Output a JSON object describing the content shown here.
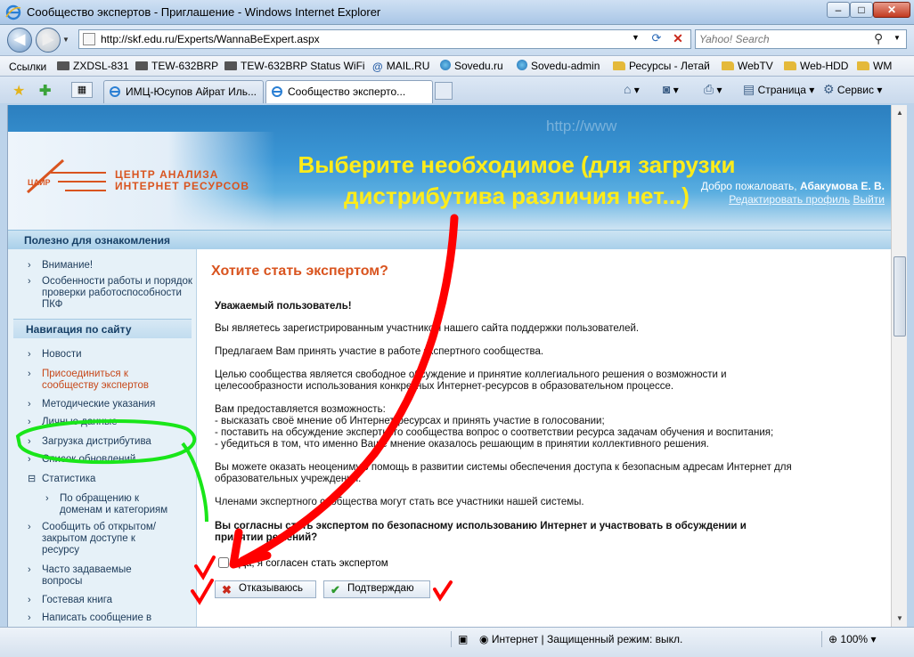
{
  "window": {
    "title": "Сообщество экспертов - Приглашение - Windows Internet Explorer",
    "minimize": "–",
    "maximize": "□",
    "close": "✕"
  },
  "address": {
    "url": "http://skf.edu.ru/Experts/WannaBeExpert.aspx",
    "search_placeholder": "Yahoo! Search"
  },
  "links_bar": {
    "label": "Ссылки",
    "items": [
      "ZXDSL-831",
      "TEW-632BRP",
      "TEW-632BRP  Status  WiFi",
      "MAIL.RU",
      "Sovedu.ru",
      "Sovedu-admin",
      "Ресурсы - Летай",
      "WebTV",
      "Web-HDD",
      "WM"
    ]
  },
  "tabs": [
    {
      "label": "ИМЦ-Юсупов Айрат Иль..."
    },
    {
      "label": "Сообщество эксперто..."
    }
  ],
  "commands": {
    "page": "Страница",
    "tools": "Сервис"
  },
  "site": {
    "logo_line1": "ЦЕНТР АНАЛИЗА",
    "logo_line2": "ИНТЕРНЕТ РЕСУРСОВ",
    "logo_abbr": "ЦАИР",
    "banner_ghost": "http://www",
    "welcome_prefix": "Добро пожаловать,",
    "welcome_user": "Абакумова Е. В.",
    "edit_profile": "Редактировать профиль",
    "logout": "Выйти",
    "useful_header": "Полезно для ознакомления"
  },
  "sidebar": {
    "useful_items": [
      "Внимание!",
      "Особенности работы и порядок проверки работоспособности ПКФ"
    ],
    "nav_header": "Навигация по сайту",
    "nav_items": [
      "Новости",
      "Присоединиться к сообществу экспертов",
      "Методические указания",
      "Личные данные",
      "Загрузка дистрибутива",
      "Список обновлений",
      "Статистика",
      "По обращению к доменам и категориям",
      "Сообщить об открытом/закрытом доступе к ресурсу",
      "Часто задаваемые вопросы",
      "Гостевая книга",
      "Написать сообщение в"
    ]
  },
  "content": {
    "title": "Хотите стать экспертом?",
    "greeting": "Уважаемый пользователь!",
    "p1": "Вы являетесь зарегистрированным участником нашего сайта поддержки пользователей.",
    "p2": "Предлагаем Вам принять участие в работе экспертного сообщества.",
    "p3a": "Целью сообщества является свободное обсуждение и принятие коллегиального решения о возможности и",
    "p3b": "целесообразности использования конкретных Интернет-ресурсов в образовательном процессе.",
    "p4": "Вам предоставляется возможность:",
    "p4a": "- высказать своё мнение об Интернет-ресурсах и принять участие в голосовании;",
    "p4b": "- поставить на обсуждение экспертного сообщества вопрос о соответствии ресурса задачам обучения и воспитания;",
    "p4c": "- убедиться в том, что именно Ваше мнение оказалось решающим в принятии коллективного решения.",
    "p5a": "Вы можете оказать неоценимую помощь в развитии системы обеспечения доступа к безопасным адресам Интернет для",
    "p5b": "образовательных учреждений.",
    "p6": "Членами экспертного сообщества могут стать все участники нашей системы.",
    "question_a": "Вы согласны стать экспертом по безопасному использованию Интернет и участвовать в обсуждении и",
    "question_b": "принятии решений?",
    "agree_label": "Да, я согласен стать экспертом",
    "decline_label": "Отказываюсь",
    "confirm_label": "Подтверждаю"
  },
  "annotation": {
    "line1": "Выберите необходимое (для загрузки",
    "line2": "дистрибутива различия нет...)"
  },
  "status": {
    "zone": "Интернет | Защищенный режим: выкл.",
    "zoom": "100%"
  },
  "colors": {
    "accent_orange": "#d9541f",
    "annotation_red": "#ff0000",
    "annotation_green": "#19e619",
    "annotation_yellow": "#ffec1a"
  }
}
